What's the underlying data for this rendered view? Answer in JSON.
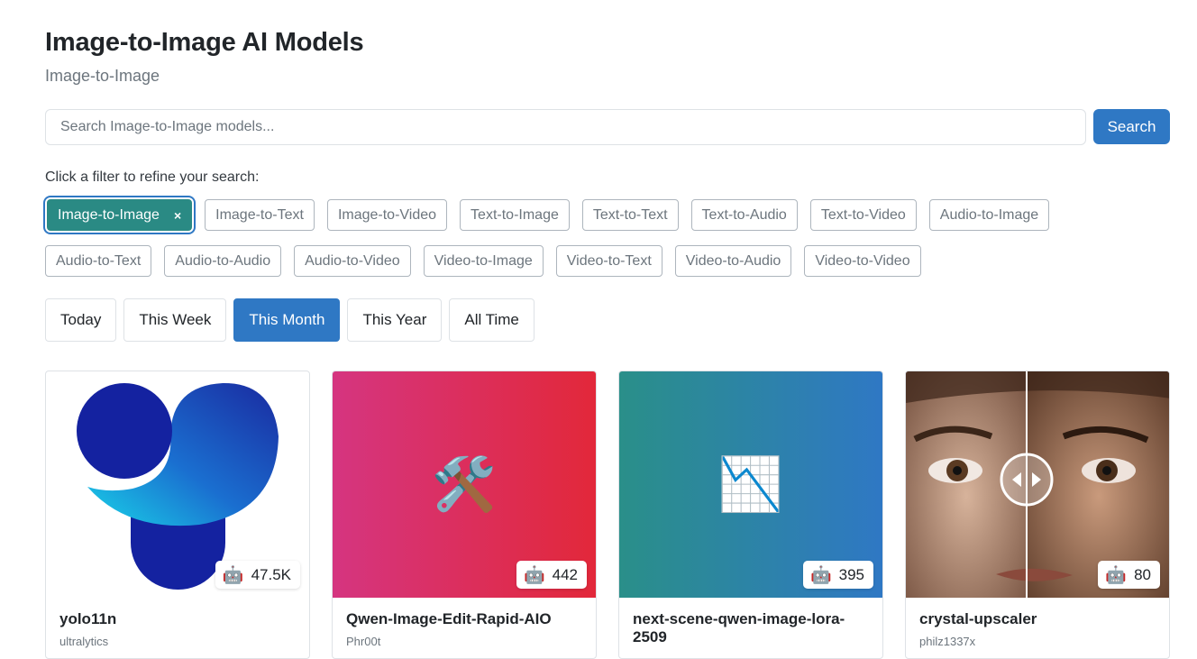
{
  "header": {
    "title": "Image-to-Image AI Models",
    "subtitle": "Image-to-Image"
  },
  "search": {
    "placeholder": "Search Image-to-Image models...",
    "value": "",
    "button_label": "Search"
  },
  "filters": {
    "hint": "Click a filter to refine your search:",
    "active_label": "Image-to-Image",
    "remove_glyph": "×",
    "row1": [
      "Image-to-Text",
      "Image-to-Video",
      "Text-to-Image",
      "Text-to-Text",
      "Text-to-Audio",
      "Text-to-Video",
      "Audio-to-Image"
    ],
    "row2": [
      "Audio-to-Text",
      "Audio-to-Audio",
      "Audio-to-Video",
      "Video-to-Image",
      "Video-to-Text",
      "Video-to-Audio",
      "Video-to-Video"
    ]
  },
  "time_filters": {
    "items": [
      "Today",
      "This Week",
      "This Month",
      "This Year",
      "All Time"
    ],
    "selected": "This Month"
  },
  "cards": [
    {
      "title": "yolo11n",
      "author": "ultralytics",
      "count": "47.5K",
      "badge_icon": "🤖",
      "thumb_icon": "ultralytics-logo"
    },
    {
      "title": "Qwen-Image-Edit-Rapid-AIO",
      "author": "Phr00t",
      "count": "442",
      "badge_icon": "🤖",
      "thumb_emoji": "🛠️"
    },
    {
      "title": "next-scene-qwen-image-lora-2509",
      "author": "",
      "count": "395",
      "badge_icon": "🤖",
      "thumb_emoji": "📉"
    },
    {
      "title": "crystal-upscaler",
      "author": "philz1337x",
      "count": "80",
      "badge_icon": "🤖",
      "thumb_icon": "face-comparison-image"
    }
  ],
  "colors": {
    "primary": "#2f78c4",
    "active_chip": "#2a8a84",
    "muted_text": "#6c757d"
  }
}
